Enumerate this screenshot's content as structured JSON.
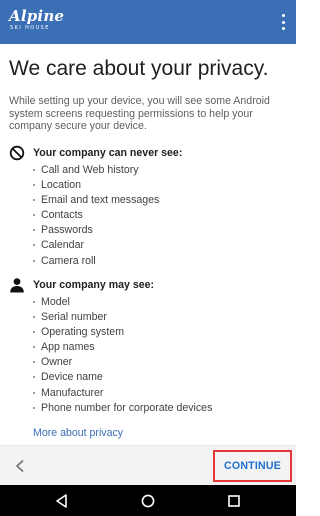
{
  "appbar": {
    "logo_main": "Alpine",
    "logo_sub": "SKI HOUSE",
    "overflow_icon": "more-vertical-icon",
    "background": "#3b6fb5"
  },
  "page": {
    "title": "We care about your privacy.",
    "intro": "While setting up your device, you will see some Android system screens requesting permissions to help your company secure your device."
  },
  "never_see": {
    "icon": "no-entry-icon",
    "title": "Your company can never see:",
    "items": [
      "Call and Web history",
      "Location",
      "Email and text messages",
      "Contacts",
      "Passwords",
      "Calendar",
      "Camera roll"
    ]
  },
  "may_see": {
    "icon": "person-icon",
    "title": "Your company may see:",
    "items": [
      "Model",
      "Serial number",
      "Operating system",
      "App names",
      "Owner",
      "Device name",
      "Manufacturer",
      "Phone number for corporate devices"
    ]
  },
  "link": {
    "more_privacy": "More about privacy",
    "color": "#3b6fb5"
  },
  "bottombar": {
    "back_icon": "chevron-left-icon",
    "continue_label": "CONTINUE",
    "continue_color": "#1e6fcf",
    "highlight_color": "#e53935"
  },
  "navbar": {
    "icons": [
      "back-triangle-icon",
      "home-circle-icon",
      "recents-square-icon"
    ]
  }
}
